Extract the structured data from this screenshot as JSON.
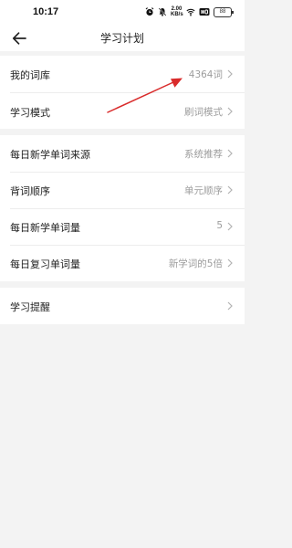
{
  "status_bar": {
    "time": "10:17",
    "network_speed_value": "2.00",
    "network_speed_unit": "KB/s",
    "battery": "88"
  },
  "header": {
    "title": "学习计划"
  },
  "settings": {
    "group1": [
      {
        "label": "我的词库",
        "value": "4364词"
      },
      {
        "label": "学习模式",
        "value": "刷词模式"
      }
    ],
    "group2": [
      {
        "label": "每日新学单词来源",
        "value": "系统推荐"
      },
      {
        "label": "背词顺序",
        "value": "单元顺序"
      },
      {
        "label": "每日新学单词量",
        "value": "5"
      },
      {
        "label": "每日复习单词量",
        "value": "新学词的5倍"
      }
    ],
    "group3": [
      {
        "label": "学习提醒",
        "value": ""
      }
    ]
  },
  "annotation": {
    "color": "#d92b2b"
  }
}
